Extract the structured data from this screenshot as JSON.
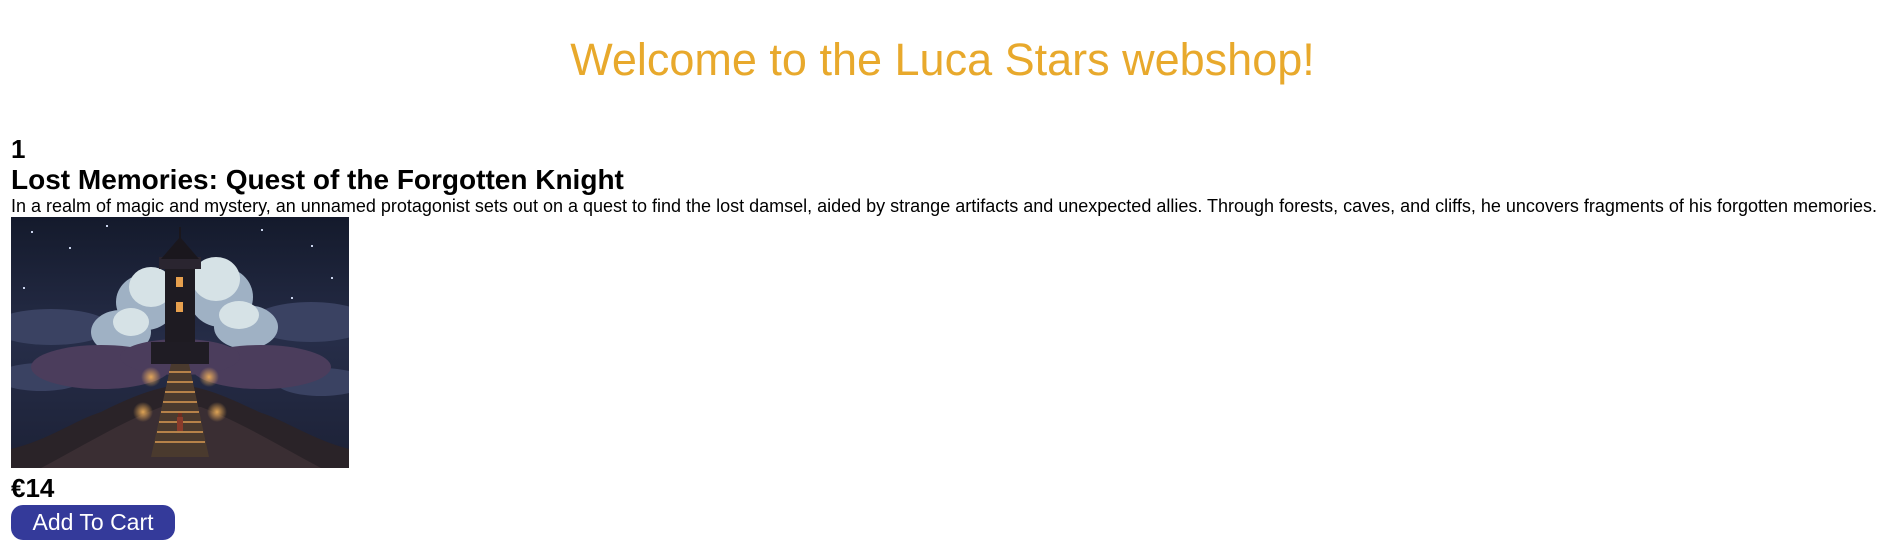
{
  "header": {
    "title": "Welcome to the Luca Stars webshop!"
  },
  "colors": {
    "title": "#E8A92C",
    "button_bg": "#343A9A",
    "button_text": "#FFFFFF"
  },
  "products": [
    {
      "id": "1",
      "name": "Lost Memories: Quest of the Forgotten Knight",
      "description": "In a realm of magic and mystery, an unnamed protagonist sets out on a quest to find the lost damsel, aided by strange artifacts and unexpected allies. Through forests, caves, and cliffs, he uncovers fragments of his forgotten memories.",
      "image_alt": "pixel-art castle on a mountain with stairs at night",
      "price": "€14",
      "add_to_cart_label": "Add To Cart"
    }
  ]
}
